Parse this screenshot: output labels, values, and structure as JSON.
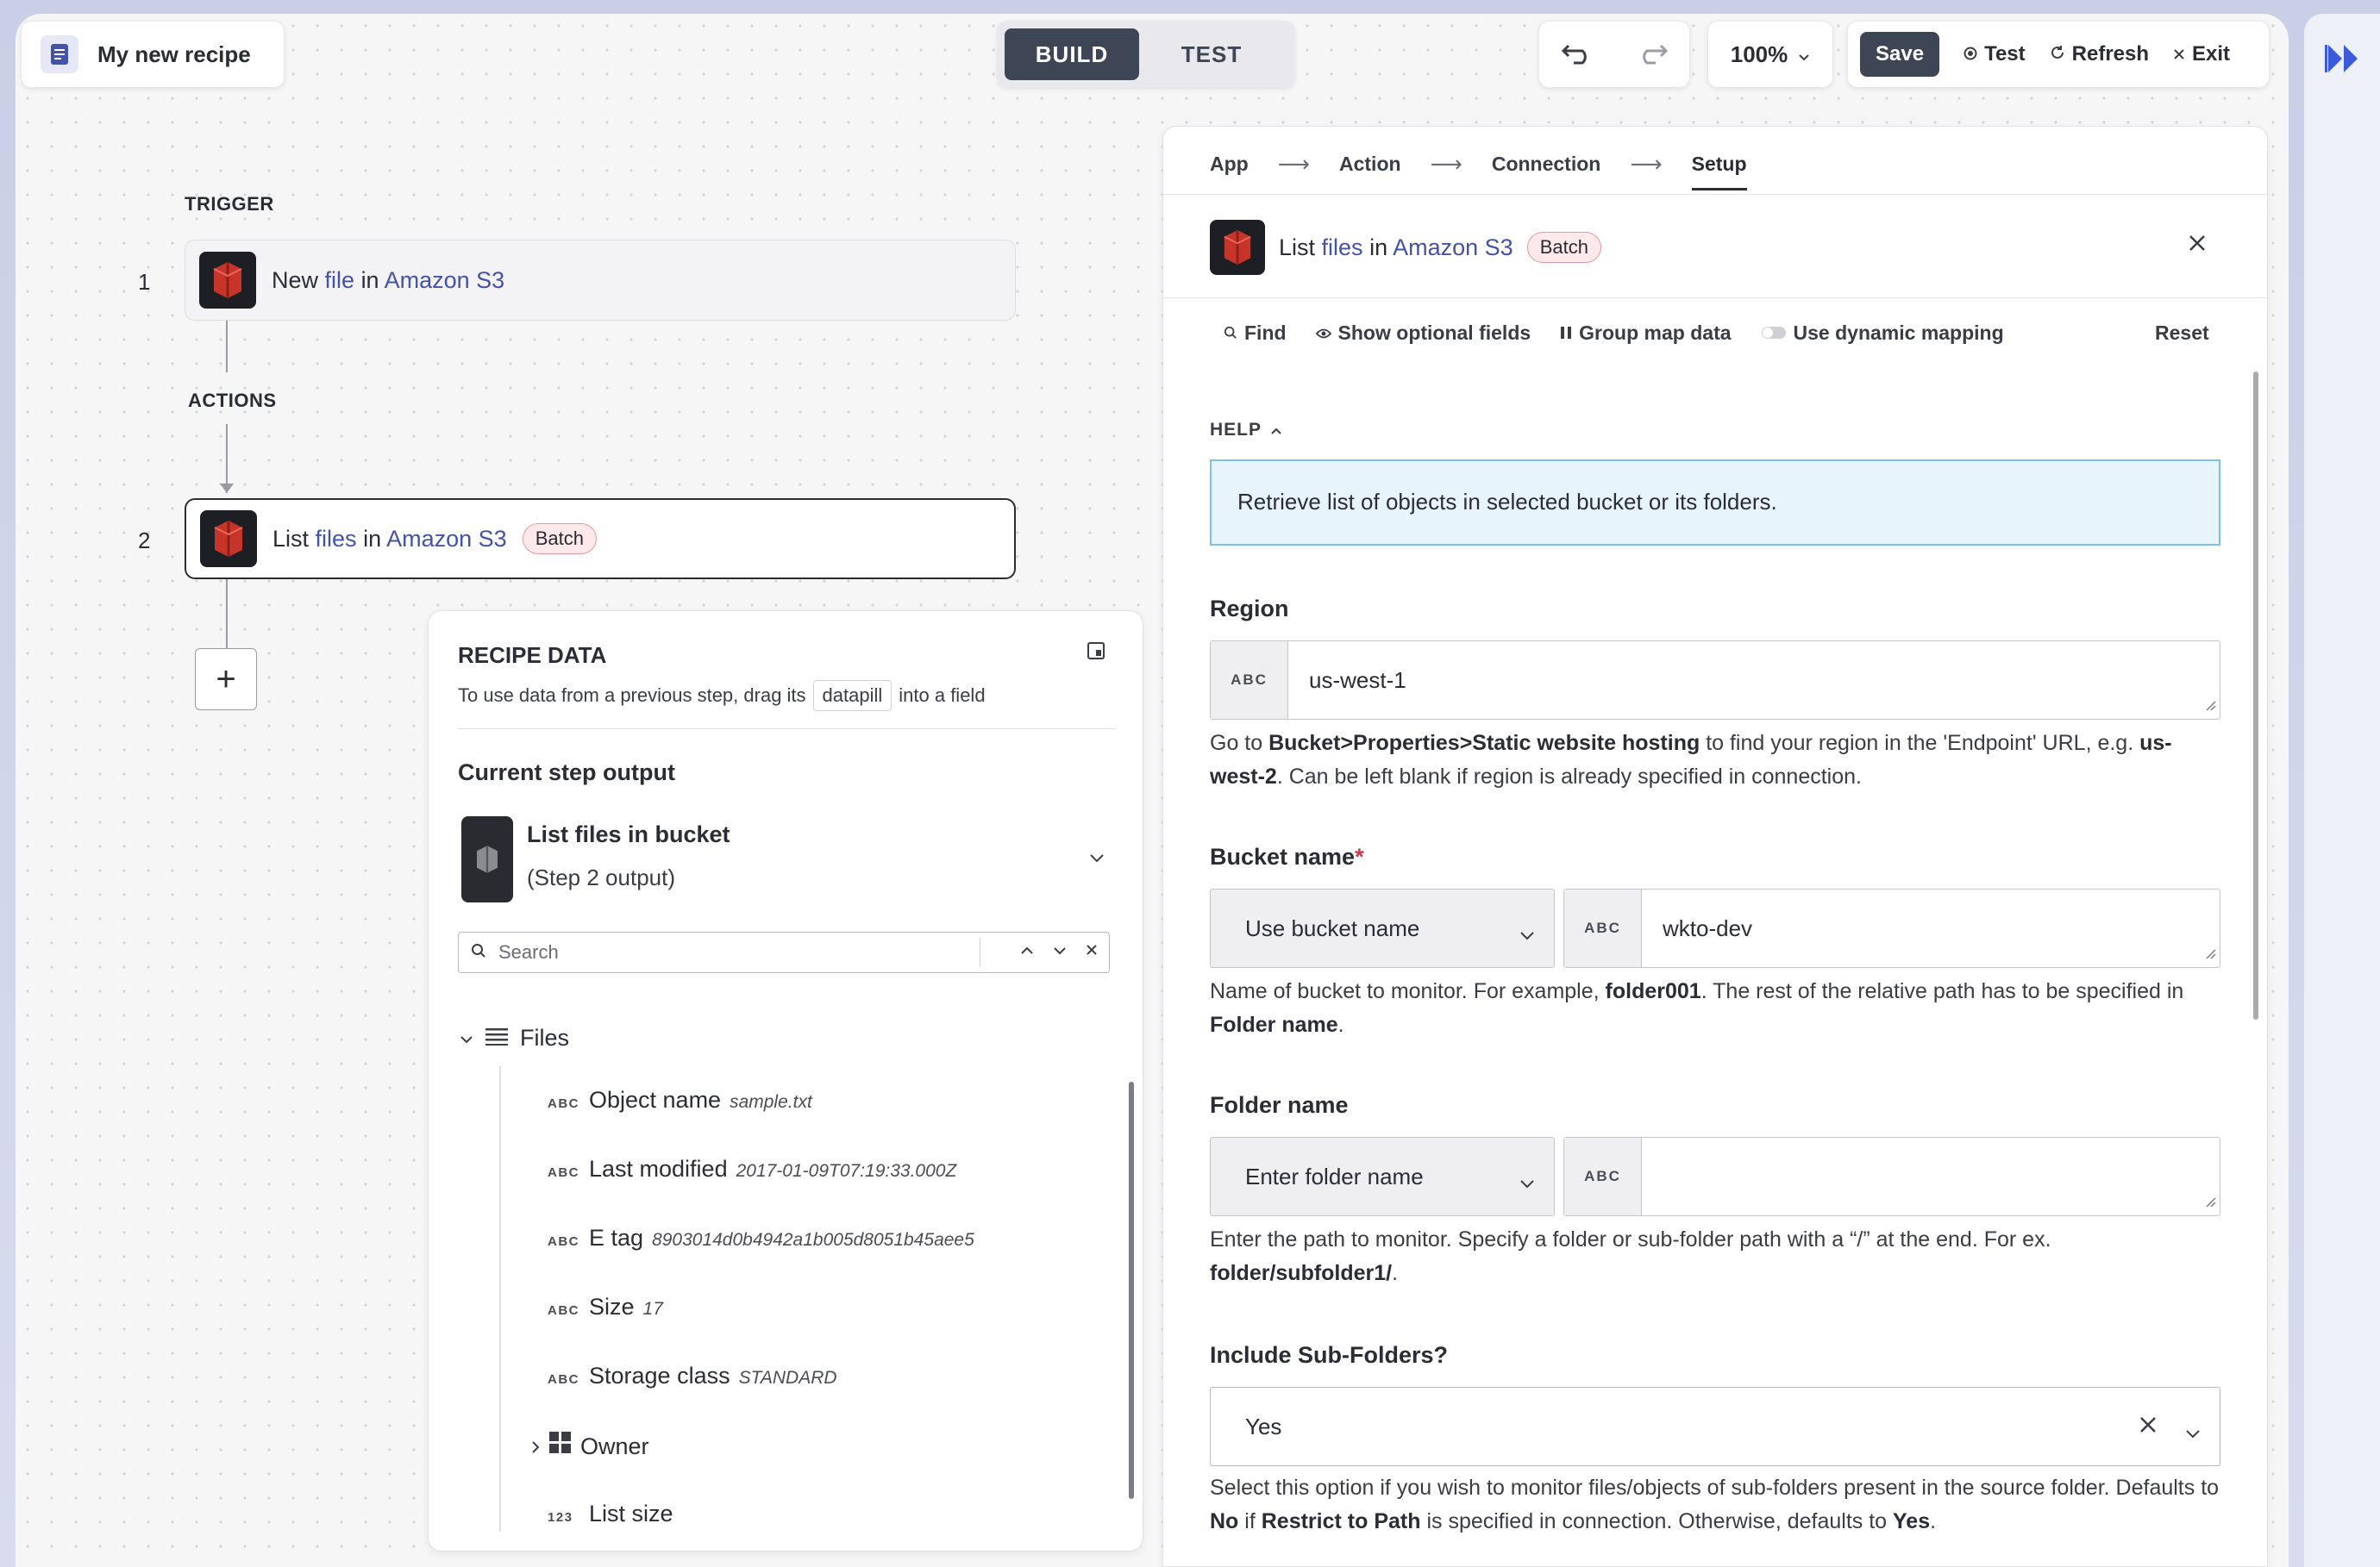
{
  "app": {
    "title": "My new recipe"
  },
  "modes": {
    "build": "BUILD",
    "test": "TEST"
  },
  "zoom": "100%",
  "toolbar": {
    "save": "Save",
    "test": "Test",
    "refresh": "Refresh",
    "exit": "Exit"
  },
  "canvas": {
    "trigger_label": "TRIGGER",
    "actions_label": "ACTIONS",
    "steps": [
      {
        "num": "1",
        "prefix": "New",
        "object": "file",
        "mid": "in",
        "app": "Amazon S3",
        "badge": ""
      },
      {
        "num": "2",
        "prefix": "List",
        "object": "files",
        "mid": "in",
        "app": "Amazon S3",
        "badge": "Batch"
      }
    ],
    "add_step": "+"
  },
  "recipe_data": {
    "title": "RECIPE DATA",
    "subtitle_a": "To use data from a previous step, drag its",
    "subtitle_pill": "datapill",
    "subtitle_b": "into a field",
    "current_output": "Current step output",
    "step_title": "List files in bucket",
    "step_sub": "(Step 2 output)",
    "search_placeholder": "Search",
    "root": "Files",
    "items": [
      {
        "type": "ABC",
        "name": "Object name",
        "sample": "sample.txt"
      },
      {
        "type": "ABC",
        "name": "Last modified",
        "sample": "2017-01-09T07:19:33.000Z"
      },
      {
        "type": "ABC",
        "name": "E tag",
        "sample": "8903014d0b4942a1b005d8051b45aee5"
      },
      {
        "type": "ABC",
        "name": "Size",
        "sample": "17"
      },
      {
        "type": "ABC",
        "name": "Storage class",
        "sample": "STANDARD"
      },
      {
        "type": "",
        "name": "Owner",
        "sample": ""
      },
      {
        "type": "123",
        "name": "List size",
        "sample": ""
      }
    ]
  },
  "config": {
    "breadcrumbs": [
      "App",
      "Action",
      "Connection",
      "Setup"
    ],
    "header": {
      "prefix": "List",
      "object": "files",
      "mid": "in",
      "app": "Amazon S3",
      "badge": "Batch"
    },
    "tools": {
      "find": "Find",
      "optional": "Show optional fields",
      "group": "Group map data",
      "dynamic": "Use dynamic mapping",
      "reset": "Reset"
    },
    "help_label": "HELP",
    "help_text": "Retrieve list of objects in selected bucket or its folders.",
    "region": {
      "label": "Region",
      "type": "ABC",
      "value": "us-west-1",
      "hint_a": "Go to ",
      "hint_b": "Bucket>Properties>Static website hosting",
      "hint_c": " to find your region in the 'Endpoint' URL, e.g. ",
      "hint_d": "us-west-2",
      "hint_e": ". Can be left blank if region is already specified in connection."
    },
    "bucket": {
      "label": "Bucket name",
      "required": "*",
      "mode": "Use bucket name",
      "type": "ABC",
      "value": "wkto-dev",
      "hint_a": "Name of bucket to monitor. For example, ",
      "hint_b": "folder001",
      "hint_c": ". The rest of the relative path has to be specified in ",
      "hint_d": "Folder name",
      "hint_e": "."
    },
    "folder": {
      "label": "Folder name",
      "mode": "Enter folder name",
      "type": "ABC",
      "value": "",
      "hint_a": "Enter the path to monitor. Specify a folder or sub-folder path with a “/” at the end. For ex. ",
      "hint_b": "folder/subfolder1/",
      "hint_c": "."
    },
    "subfolders": {
      "label": "Include Sub-Folders?",
      "value": "Yes",
      "hint_a": "Select this option if you wish to monitor files/objects of sub-folders present in the source folder. Defaults to ",
      "hint_b": "No",
      "hint_c": " if ",
      "hint_d": "Restrict to Path",
      "hint_e": " is specified in connection. Otherwise, defaults to ",
      "hint_f": "Yes",
      "hint_g": "."
    }
  }
}
